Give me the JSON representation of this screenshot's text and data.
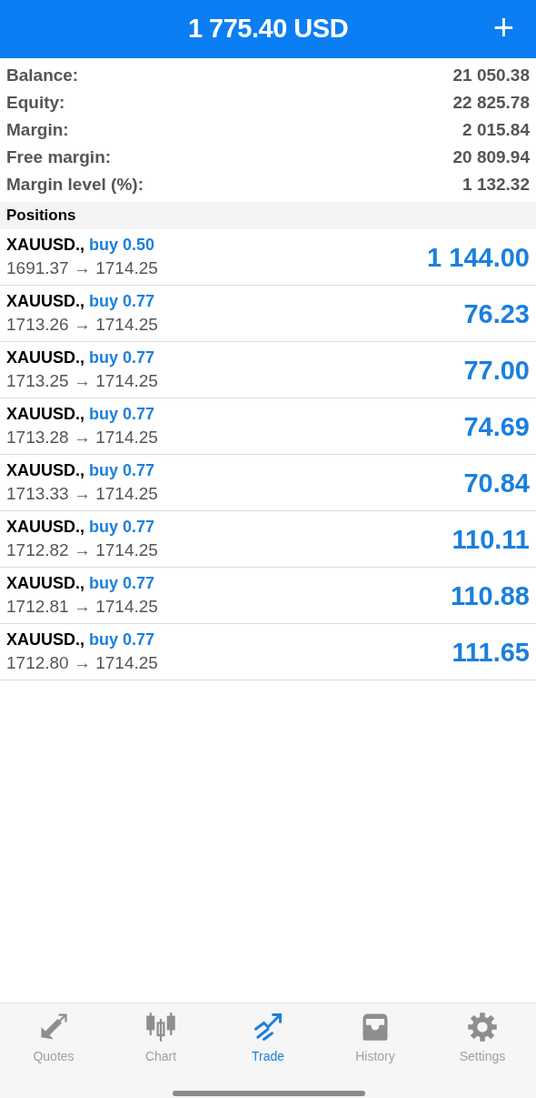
{
  "header": {
    "title": "1 775.40 USD",
    "action": "+"
  },
  "summary": [
    {
      "label": "Balance:",
      "value": "21 050.38"
    },
    {
      "label": "Equity:",
      "value": "22 825.78"
    },
    {
      "label": "Margin:",
      "value": "2 015.84"
    },
    {
      "label": "Free margin:",
      "value": "20 809.94"
    },
    {
      "label": "Margin level (%):",
      "value": "1 132.32"
    }
  ],
  "positions_title": "Positions",
  "positions": [
    {
      "symbol": "XAUUSD.,",
      "order": "buy 0.50",
      "prices": "1691.37 → 1714.25",
      "profit": "1 144.00"
    },
    {
      "symbol": "XAUUSD.,",
      "order": "buy 0.77",
      "prices": "1713.26 → 1714.25",
      "profit": "76.23"
    },
    {
      "symbol": "XAUUSD.,",
      "order": "buy 0.77",
      "prices": "1713.25 → 1714.25",
      "profit": "77.00"
    },
    {
      "symbol": "XAUUSD.,",
      "order": "buy 0.77",
      "prices": "1713.28 → 1714.25",
      "profit": "74.69"
    },
    {
      "symbol": "XAUUSD.,",
      "order": "buy 0.77",
      "prices": "1713.33 → 1714.25",
      "profit": "70.84"
    },
    {
      "symbol": "XAUUSD.,",
      "order": "buy 0.77",
      "prices": "1712.82 → 1714.25",
      "profit": "110.11"
    },
    {
      "symbol": "XAUUSD.,",
      "order": "buy 0.77",
      "prices": "1712.81 → 1714.25",
      "profit": "110.88"
    },
    {
      "symbol": "XAUUSD.,",
      "order": "buy 0.77",
      "prices": "1712.80 → 1714.25",
      "profit": "111.65"
    }
  ],
  "tabs": [
    {
      "label": "Quotes",
      "selected": false
    },
    {
      "label": "Chart",
      "selected": false
    },
    {
      "label": "Trade",
      "selected": true
    },
    {
      "label": "History",
      "selected": false
    },
    {
      "label": "Settings",
      "selected": false
    }
  ]
}
